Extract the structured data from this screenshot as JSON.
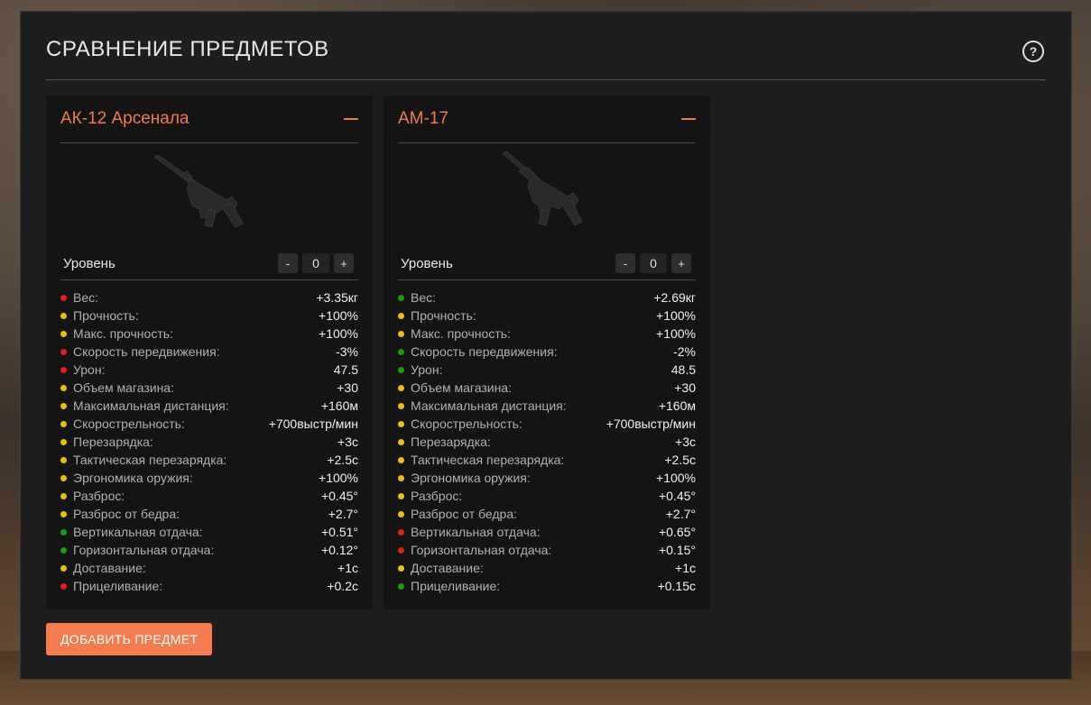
{
  "title": "СРАВНЕНИЕ ПРЕДМЕТОВ",
  "help_icon": "?",
  "add_button": "ДОБАВИТЬ ПРЕДМЕТ",
  "colors": {
    "green": "#1a9a1a",
    "yellow": "#e8c20a",
    "red": "#e01f1f",
    "accent": "#f47c4f"
  },
  "items": [
    {
      "name": "АК-12 Арсенала",
      "icon": "rifle-image",
      "level": {
        "label": "Уровень",
        "minus": "-",
        "value": "0",
        "plus": "+"
      },
      "stats": [
        {
          "label": "Вес:",
          "value": "+3.35кг",
          "status": "red"
        },
        {
          "label": "Прочность:",
          "value": "+100%",
          "status": "yellow"
        },
        {
          "label": "Макс. прочность:",
          "value": "+100%",
          "status": "yellow"
        },
        {
          "label": "Скорость передвижения:",
          "value": "-3%",
          "status": "red"
        },
        {
          "label": "Урон:",
          "value": "47.5",
          "status": "red"
        },
        {
          "label": "Объем магазина:",
          "value": "+30",
          "status": "yellow"
        },
        {
          "label": "Максимальная дистанция:",
          "value": "+160м",
          "status": "yellow"
        },
        {
          "label": "Скорострельность:",
          "value": "+700выстр/мин",
          "status": "yellow"
        },
        {
          "label": "Перезарядка:",
          "value": "+3с",
          "status": "yellow"
        },
        {
          "label": "Тактическая перезарядка:",
          "value": "+2.5с",
          "status": "yellow"
        },
        {
          "label": "Эргономика оружия:",
          "value": "+100%",
          "status": "yellow"
        },
        {
          "label": "Разброс:",
          "value": "+0.45°",
          "status": "yellow"
        },
        {
          "label": "Разброс от бедра:",
          "value": "+2.7°",
          "status": "yellow"
        },
        {
          "label": "Вертикальная отдача:",
          "value": "+0.51°",
          "status": "green"
        },
        {
          "label": "Горизонтальная отдача:",
          "value": "+0.12°",
          "status": "green"
        },
        {
          "label": "Доставание:",
          "value": "+1с",
          "status": "yellow"
        },
        {
          "label": "Прицеливание:",
          "value": "+0.2с",
          "status": "red"
        }
      ]
    },
    {
      "name": "АМ-17",
      "icon": "rifle-image",
      "level": {
        "label": "Уровень",
        "minus": "-",
        "value": "0",
        "plus": "+"
      },
      "stats": [
        {
          "label": "Вес:",
          "value": "+2.69кг",
          "status": "green"
        },
        {
          "label": "Прочность:",
          "value": "+100%",
          "status": "yellow"
        },
        {
          "label": "Макс. прочность:",
          "value": "+100%",
          "status": "yellow"
        },
        {
          "label": "Скорость передвижения:",
          "value": "-2%",
          "status": "green"
        },
        {
          "label": "Урон:",
          "value": "48.5",
          "status": "green"
        },
        {
          "label": "Объем магазина:",
          "value": "+30",
          "status": "yellow"
        },
        {
          "label": "Максимальная дистанция:",
          "value": "+160м",
          "status": "yellow"
        },
        {
          "label": "Скорострельность:",
          "value": "+700выстр/мин",
          "status": "yellow"
        },
        {
          "label": "Перезарядка:",
          "value": "+3с",
          "status": "yellow"
        },
        {
          "label": "Тактическая перезарядка:",
          "value": "+2.5с",
          "status": "yellow"
        },
        {
          "label": "Эргономика оружия:",
          "value": "+100%",
          "status": "yellow"
        },
        {
          "label": "Разброс:",
          "value": "+0.45°",
          "status": "yellow"
        },
        {
          "label": "Разброс от бедра:",
          "value": "+2.7°",
          "status": "yellow"
        },
        {
          "label": "Вертикальная отдача:",
          "value": "+0.65°",
          "status": "red"
        },
        {
          "label": "Горизонтальная отдача:",
          "value": "+0.15°",
          "status": "red"
        },
        {
          "label": "Доставание:",
          "value": "+1с",
          "status": "yellow"
        },
        {
          "label": "Прицеливание:",
          "value": "+0.15с",
          "status": "green"
        }
      ]
    }
  ]
}
